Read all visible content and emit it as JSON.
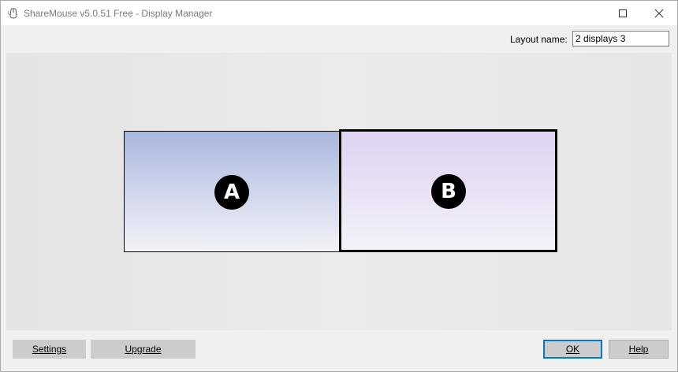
{
  "window": {
    "title": "ShareMouse v5.0.51 Free - Display Manager",
    "app_icon": "sharemouse-mouse-icon",
    "controls": {
      "maximize_icon": "maximize-icon",
      "close_icon": "close-icon"
    }
  },
  "layout": {
    "label": "Layout name:",
    "value": "2 displays 3"
  },
  "displays": [
    {
      "id": "A",
      "label": "A",
      "selected": false,
      "color_top": "#a8b7de"
    },
    {
      "id": "B",
      "label": "B",
      "selected": true,
      "color_top": "#dfd3f1"
    }
  ],
  "buttons": {
    "settings": "Settings",
    "upgrade": "Upgrade",
    "ok": "OK",
    "help": "Help"
  },
  "colors": {
    "focus_border": "#0078d7",
    "button_face": "#cccccc"
  }
}
